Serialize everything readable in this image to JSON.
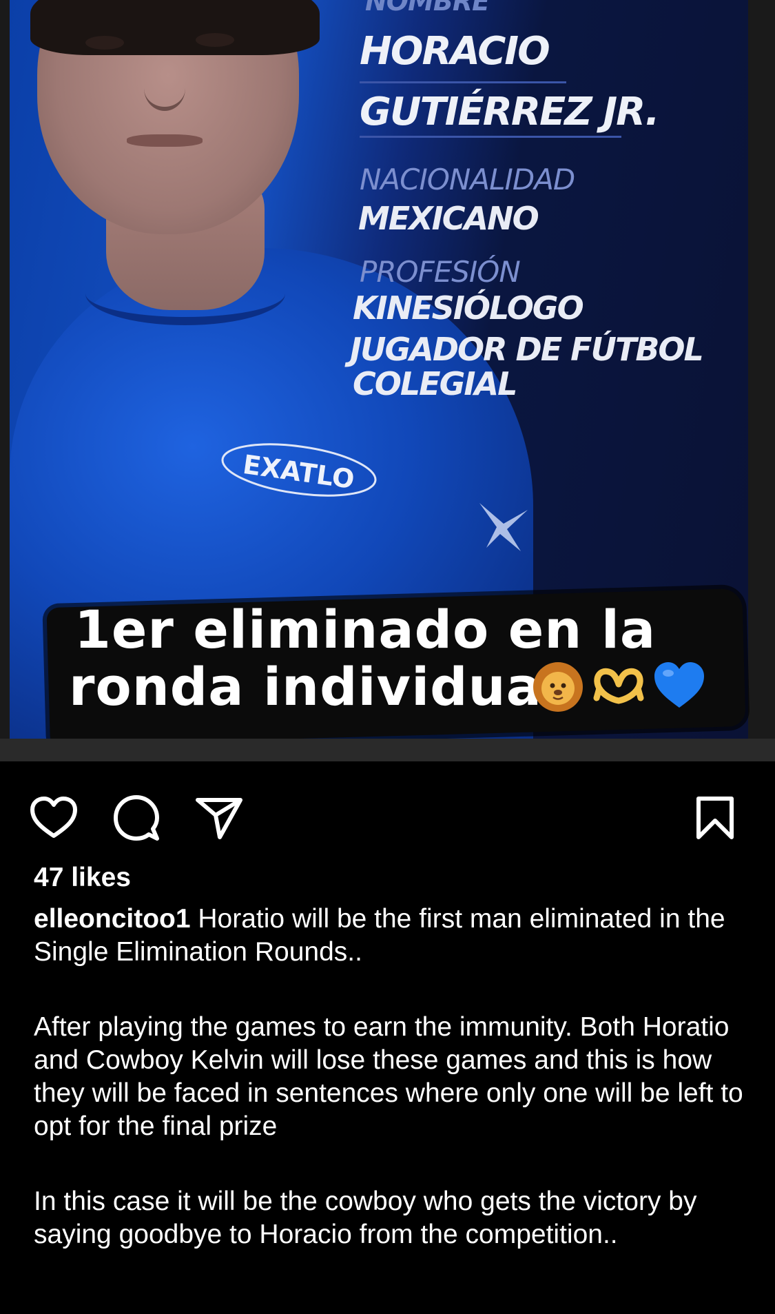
{
  "post": {
    "image": {
      "info": {
        "top_label": "NOMBRE",
        "name_line1": "HORACIO",
        "name_line2": "GUTIÉRREZ JR.",
        "nationality_label": "NACIONALIDAD",
        "nationality_value": "MEXICANO",
        "profession_label": "PROFESIÓN",
        "profession_line1": "KINESIÓLOGO",
        "profession_line2": "JUGADOR DE FÚTBOL",
        "profession_line3": "COLEGIAL"
      },
      "shirt_logo_text": "EXATLO",
      "caption_overlay_line1": "1er eliminado en la",
      "caption_overlay_line2": "ronda individual",
      "caption_overlay_emojis": [
        "lion-face-emoji",
        "heart-hands-emoji",
        "blue-heart-emoji"
      ]
    },
    "actions": {
      "like_icon": "heart-outline-icon",
      "comment_icon": "comment-bubble-icon",
      "share_icon": "paper-plane-icon",
      "save_icon": "bookmark-outline-icon"
    },
    "likes_text": "47 likes",
    "username": "elleoncitoo1",
    "caption_p1": "Horatio will be the first man eliminated in the Single Elimination Rounds..",
    "caption_p2": "After playing the games to earn the immunity. Both Horatio and Cowboy Kelvin will lose these games and this is how they will be faced in sentences where only one will be left to opt for the final prize",
    "caption_p3": "In this case it will be the cowboy who gets the victory by saying goodbye to Horacio from the competition..",
    "colors": {
      "background": "#000000",
      "text": "#ffffff",
      "shirt_blue": "#1450c2",
      "card_navy": "#0a1235",
      "blue_heart": "#1e7cf0"
    }
  }
}
